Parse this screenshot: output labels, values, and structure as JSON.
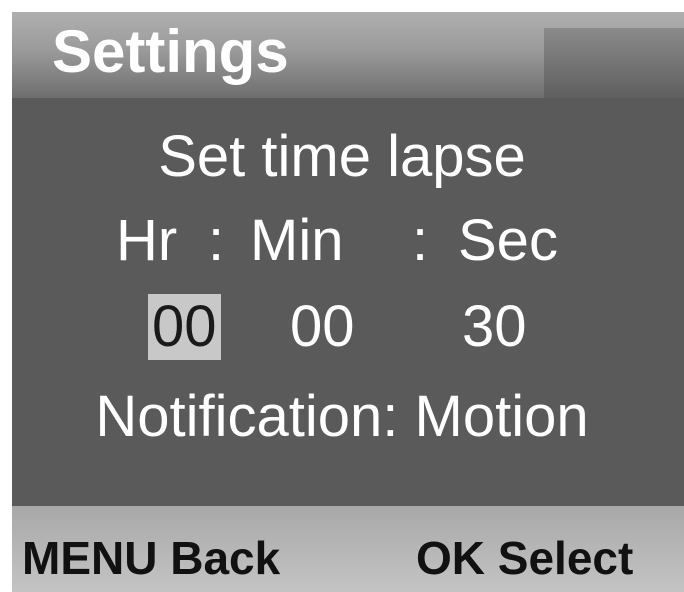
{
  "header": {
    "title": "Settings"
  },
  "time_lapse": {
    "title": "Set time lapse",
    "labels": {
      "hr": "Hr",
      "sep1": ":",
      "min": "Min",
      "sep2": ":",
      "sec": "Sec"
    },
    "values": {
      "hours": "00",
      "minutes": "00",
      "seconds": "30"
    },
    "selected_field": "hours"
  },
  "notification": {
    "text": "Notification: Motion"
  },
  "footer": {
    "back_hint": "MENU Back",
    "select_hint": "OK Select"
  },
  "colors": {
    "panel": "#5a5a5a",
    "selection": "#c8c8c8",
    "text": "#ffffff"
  }
}
